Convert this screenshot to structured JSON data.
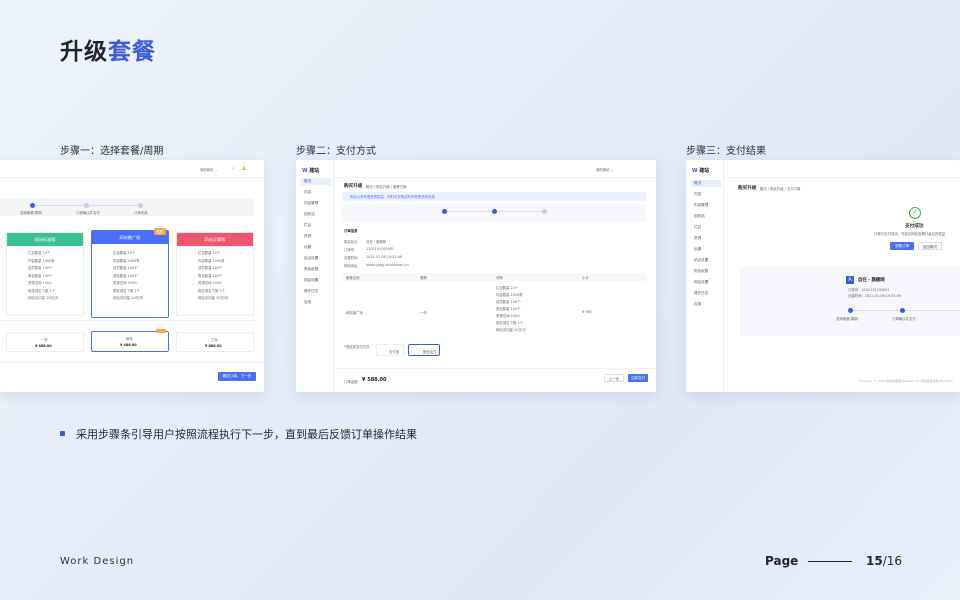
{
  "title_part1": "升级",
  "title_part2": "套餐",
  "steps": [
    "步骤一：选择套餐/周期",
    "步骤二：支付方式",
    "步骤三：支付结果"
  ],
  "caption": "采用步骤条引导用户按照流程执行下一步，直到最后反馈订单操作结果",
  "footer": {
    "brand": "Work Design",
    "page_label": "Page",
    "current": "15",
    "total": "/16"
  },
  "shot1": {
    "progress": [
      "选择套餐/周期",
      "订单确认并支付",
      "订单完成"
    ],
    "plans": [
      {
        "name": "网站标准版",
        "color": "#3bc18f",
        "tag": ""
      },
      {
        "name": "网站推广版",
        "color": "#4c6ef5",
        "tag": "推荐"
      },
      {
        "name": "网站至尊版",
        "color": "#f0566f",
        "tag": ""
      }
    ],
    "features": [
      "栏目数量 10个",
      "内容数量 1000条",
      "成员数量 100个",
      "角色数量 100个",
      "资源空间 100G",
      "绑定域名个数 1个",
      "网站访问量 20次/天"
    ],
    "periods": [
      {
        "label": "一年",
        "price": "¥ 488.00"
      },
      {
        "label": "两年",
        "price": "¥ 488.00"
      },
      {
        "label": "三年",
        "price": "¥ 888.00"
      }
    ],
    "next_button": "确定订单，下一步"
  },
  "shot2": {
    "logo": "建站",
    "page_title": "购买升级",
    "breadcrumb": "概况 / 购买升级 / 套餐方案",
    "notice": "购买以享有更多的权益，同时可在购买时享受更多的优惠",
    "nav": [
      "概况",
      "内容",
      "内容管理",
      "回收站",
      "栏目",
      "资源",
      "设置",
      "站点设置",
      "角色权限",
      "网站设置",
      "操作日志",
      "应用"
    ],
    "section": "订单信息",
    "info": [
      {
        "k": "购买站点",
        "v": "自在 · 旗舰网"
      },
      {
        "k": "订单号",
        "v": "2102191200001"
      },
      {
        "k": "创建时间",
        "v": "2022-01-08 19:51:49"
      },
      {
        "k": "网站地址",
        "v": "https://wgj.ziyuhuiben.cn"
      }
    ],
    "table_head": [
      "套餐名称",
      "周期",
      "详情",
      "小计"
    ],
    "table_row": {
      "name": "网站推广版",
      "period": "一年",
      "price": "¥ 580"
    },
    "pay_label": "*请选择支付方式",
    "pay_methods": [
      "支付宝",
      "微信支付"
    ],
    "total_label": "订单金额：",
    "total": "¥ 588.00",
    "prev_btn": "上一步",
    "confirm_btn": "立即支付"
  },
  "shot3": {
    "logo": "建站",
    "page_title": "购买升级",
    "breadcrumb": "概况 / 购买升级 / 支付订单",
    "success_title": "支付成功",
    "success_desc": "订单已支付成功，可前往网站查看升级后的权益",
    "btn1": "查看订单",
    "btn2": "返回概况",
    "site": "自在 · 旗舰网",
    "order_no": "订单号：2102191200001",
    "time": "创建时间：2022-01-08 19:51:49",
    "progress": [
      "选择套餐/周期",
      "订单确认并支付"
    ],
    "copyright": "Copyright © 2022 建站旗舰版 Powered By 网站建设系统 All rights"
  }
}
